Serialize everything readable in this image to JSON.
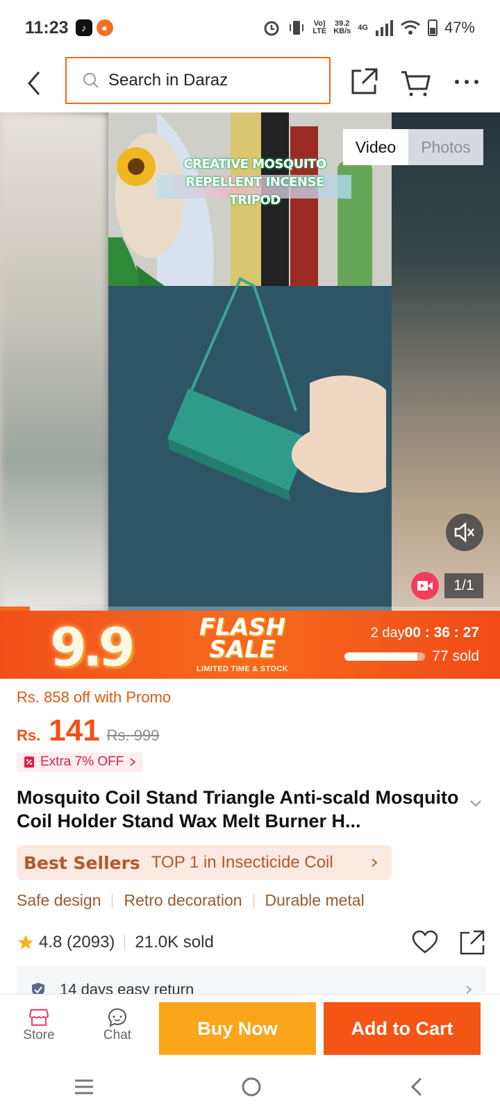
{
  "status": {
    "time": "11:23",
    "net_lte": "Vol\nLTE",
    "speed_value": "39.2",
    "speed_unit": "KB/s",
    "network": "4G",
    "battery": "47%"
  },
  "header": {
    "search_placeholder": "Search in Daraz"
  },
  "gallery": {
    "caption_line1": "CREATIVE MOSQUITO",
    "caption_line2": "REPELLENT INCENSE TRIPOD",
    "tab_video": "Video",
    "tab_photos": "Photos",
    "counter": "1/1",
    "playback_progress": 0.06
  },
  "flash": {
    "big_text": "9.9",
    "title_line1": "FLASH",
    "title_line2": "SALE",
    "subtitle": "LIMITED TIME & STOCK",
    "countdown_days": "2 day",
    "countdown_time": "00 : 36 : 27",
    "sold": "77 sold",
    "sold_progress": 0.9
  },
  "price": {
    "promo": "Rs. 858 off with Promo",
    "currency": "Rs.",
    "value": "141",
    "original": "Rs. 999",
    "extra": "Extra 7% OFF"
  },
  "product": {
    "title": "Mosquito Coil Stand Triangle Anti-scald Mosquito Coil Holder Stand Wax Melt Burner H...",
    "bestseller_label": "Best Sellers",
    "bestseller_rank": "TOP 1 in Insecticide Coil",
    "features": [
      "Safe design",
      "Retro decoration",
      "Durable metal"
    ],
    "rating": "4.8 (2093)",
    "sold": "21.0K sold",
    "return_policy": "14 days easy return"
  },
  "bottom_bar": {
    "store_label": "Store",
    "chat_label": "Chat",
    "buy_now_label": "Buy Now",
    "add_to_cart_label": "Add to Cart"
  },
  "colors": {
    "accent": "#f26a1b",
    "buy_now": "#faa51a",
    "add_to_cart": "#f55514",
    "bestseller_text": "#b15a2a"
  }
}
